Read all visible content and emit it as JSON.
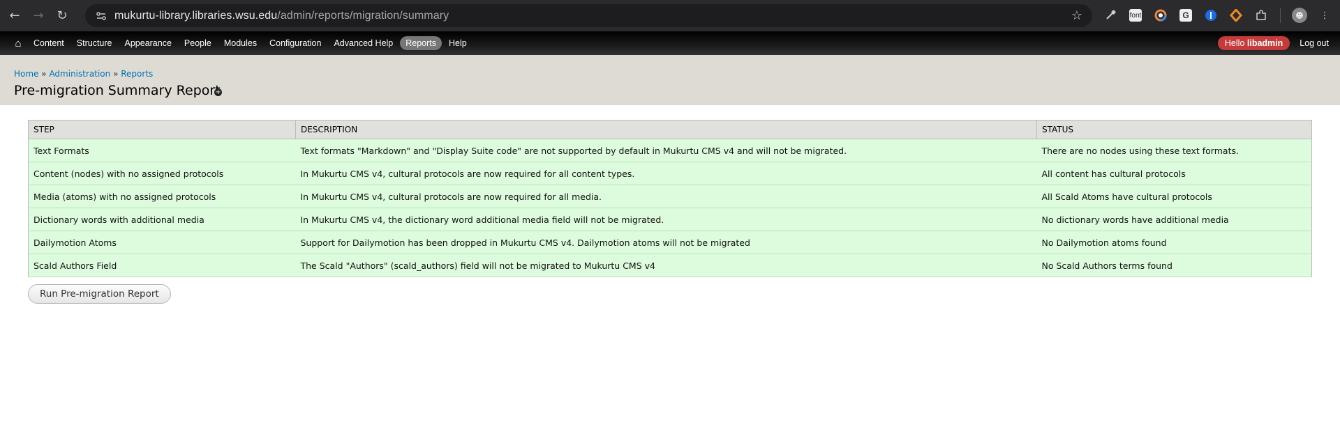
{
  "browser": {
    "url_host": "mukurtu-library.libraries.wsu.edu",
    "url_path": "/admin/reports/migration/summary",
    "extensions": [
      {
        "name": "eyedropper-icon",
        "label": ""
      },
      {
        "name": "font-ext-icon",
        "label": "font"
      },
      {
        "name": "color-ext-icon",
        "label": ""
      },
      {
        "name": "g-ext-icon",
        "label": "G"
      },
      {
        "name": "password-ext-icon",
        "label": ""
      },
      {
        "name": "orange-ext-icon",
        "label": ""
      },
      {
        "name": "puzzle-icon",
        "label": ""
      }
    ]
  },
  "toolbar": {
    "items": [
      "Content",
      "Structure",
      "Appearance",
      "People",
      "Modules",
      "Configuration",
      "Advanced Help",
      "Reports",
      "Help"
    ],
    "active": "Reports",
    "hello_prefix": "Hello ",
    "user": "libadmin",
    "logout": "Log out"
  },
  "breadcrumb": {
    "home": "Home",
    "sep": "»",
    "administration": "Administration",
    "reports": "Reports"
  },
  "page": {
    "title": "Pre-migration Summary Report"
  },
  "table": {
    "headers": [
      "STEP",
      "DESCRIPTION",
      "STATUS"
    ],
    "rows": [
      [
        "Text Formats",
        "Text formats \"Markdown\" and \"Display Suite code\" are not supported by default in Mukurtu CMS v4 and will not be migrated.",
        "There are no nodes using these text formats."
      ],
      [
        "Content (nodes) with no assigned protocols",
        "In Mukurtu CMS v4, cultural protocols are now required for all content types.",
        "All content has cultural protocols"
      ],
      [
        "Media (atoms) with no assigned protocols",
        "In Mukurtu CMS v4, cultural protocols are now required for all media.",
        "All Scald Atoms have cultural protocols"
      ],
      [
        "Dictionary words with additional media",
        "In Mukurtu CMS v4, the dictionary word additional media field will not be migrated.",
        "No dictionary words have additional media"
      ],
      [
        "Dailymotion Atoms",
        "Support for Dailymotion has been dropped in Mukurtu CMS v4. Dailymotion atoms will not be migrated",
        "No Dailymotion atoms found"
      ],
      [
        "Scald Authors Field",
        "The Scald \"Authors\" (scald_authors) field will not be migrated to Mukurtu CMS v4",
        "No Scald Authors terms found"
      ]
    ]
  },
  "run_button": "Run Pre-migration Report"
}
